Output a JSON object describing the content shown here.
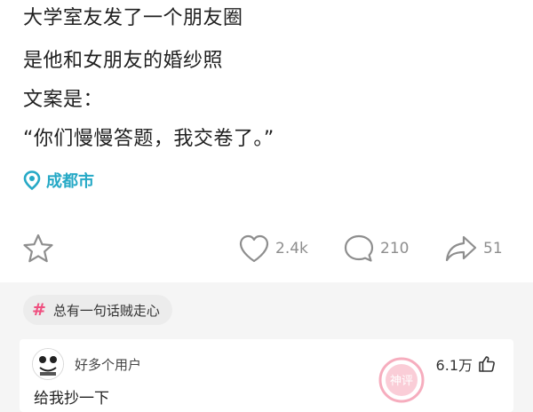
{
  "post": {
    "lines": [
      "大学室友发了一个朋友圈",
      "是他和女朋友的婚纱照",
      "文案是：",
      "“你们慢慢答题，我交卷了。”"
    ],
    "location": "成都市"
  },
  "actions": {
    "likes": "2.4k",
    "comments": "210",
    "shares": "51"
  },
  "topic": {
    "hash": "#",
    "label": "总有一句话贼走心"
  },
  "comment": {
    "user_name": "好多个用户",
    "like_count": "6.1万",
    "text": "给我抄一下",
    "stamp_text": "神评"
  },
  "colors": {
    "location": "#26a9c6",
    "hash": "#ef4f7f",
    "icon_gray": "#8e8e8e",
    "stamp": "#f06b8a"
  },
  "icons": [
    "location-pin-icon",
    "star-icon",
    "heart-icon",
    "comment-bubble-icon",
    "share-arrow-icon",
    "thumbs-up-icon",
    "avatar-meme-icon",
    "god-comment-stamp-icon"
  ]
}
